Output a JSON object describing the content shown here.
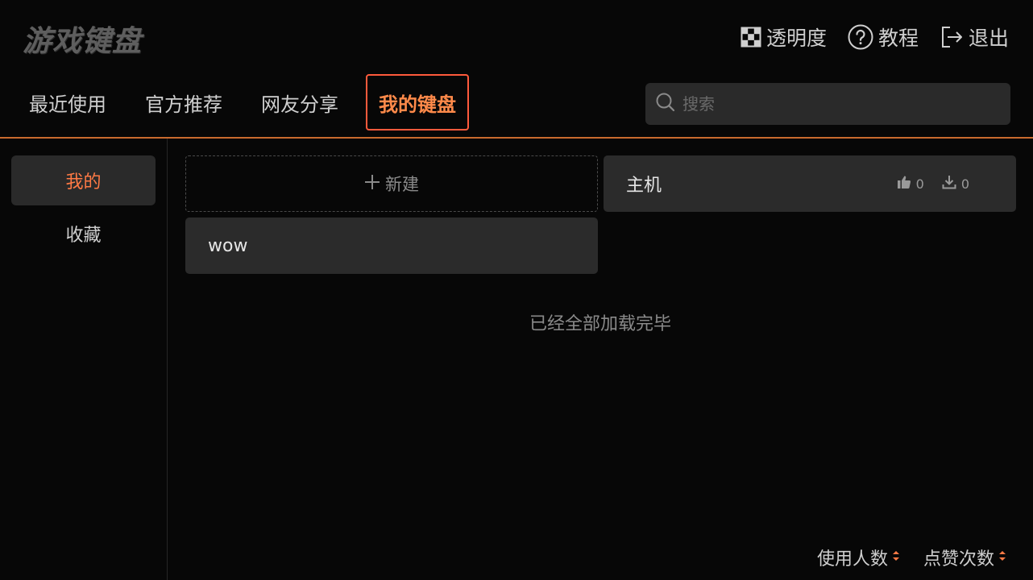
{
  "app": {
    "title": "游戏键盘"
  },
  "header": {
    "actions": [
      {
        "label": "透明度",
        "icon": "transparency-icon"
      },
      {
        "label": "教程",
        "icon": "help-icon"
      },
      {
        "label": "退出",
        "icon": "exit-icon"
      }
    ]
  },
  "tabs": [
    {
      "label": "最近使用",
      "active": false
    },
    {
      "label": "官方推荐",
      "active": false
    },
    {
      "label": "网友分享",
      "active": false
    },
    {
      "label": "我的键盘",
      "active": true
    }
  ],
  "search": {
    "placeholder": "搜索",
    "value": ""
  },
  "sidebar": {
    "items": [
      {
        "label": "我的",
        "active": true
      },
      {
        "label": "收藏",
        "active": false
      }
    ]
  },
  "content": {
    "new_label": "新建",
    "cards": [
      {
        "name": "wow"
      },
      {
        "name": "主机",
        "likes": "0",
        "downloads": "0"
      }
    ],
    "loaded_text": "已经全部加载完毕"
  },
  "sort": {
    "users_label": "使用人数",
    "likes_label": "点赞次数"
  },
  "colors": {
    "accent": "#ff7a45",
    "active_border": "#ff5a3c",
    "divider": "#c96a2e",
    "background": "#070707",
    "card": "#2b2b2b"
  }
}
